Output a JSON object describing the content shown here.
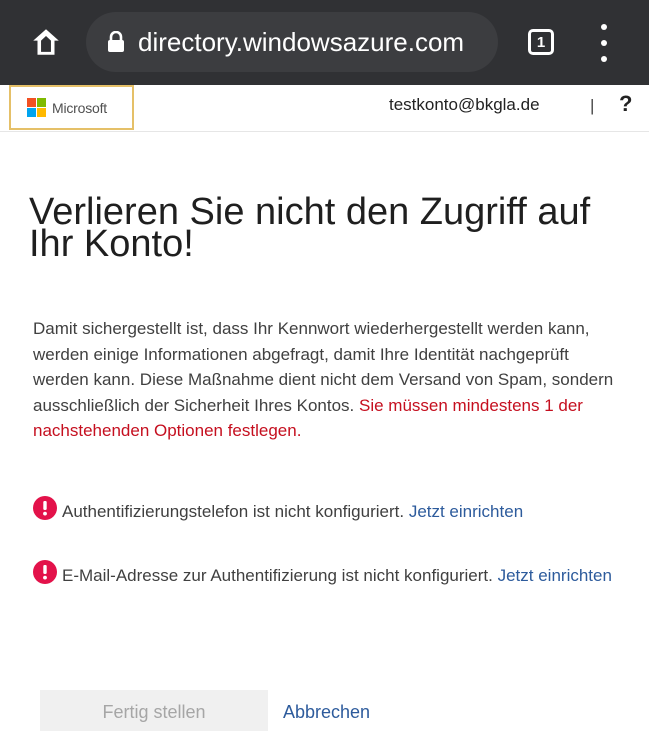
{
  "browser": {
    "url": "directory.windowsazure.com",
    "tab_count": "1"
  },
  "header": {
    "brand": "Microsoft",
    "user_email": "testkonto@bkgla.de",
    "divider": "|",
    "help": "?"
  },
  "main": {
    "title": "Verlieren Sie nicht den Zugriff auf Ihr Konto!",
    "description": "Damit sichergestellt ist, dass Ihr Kennwort wiederhergestellt werden kann, werden einige Informationen abgefragt, damit Ihre Identität nachgeprüft werden kann. Diese Maßnahme dient nicht dem Versand von Spam, sondern ausschließlich der Sicherheit Ihres Kontos.",
    "warning": "Sie müssen mindestens 1 der nachstehenden Optionen festlegen.",
    "options": [
      {
        "text": "Authentifizierungstelefon ist nicht konfiguriert.",
        "link": "Jetzt einrichten"
      },
      {
        "text": "E-Mail-Adresse zur Authentifizierung ist nicht konfiguriert.",
        "link": "Jetzt einrichten"
      }
    ],
    "finish_label": "Fertig stellen",
    "cancel_label": "Abbrechen"
  },
  "colors": {
    "accent_link": "#2d5b9c",
    "warning_red": "#c50f1f",
    "alert_icon": "#e3124a"
  }
}
